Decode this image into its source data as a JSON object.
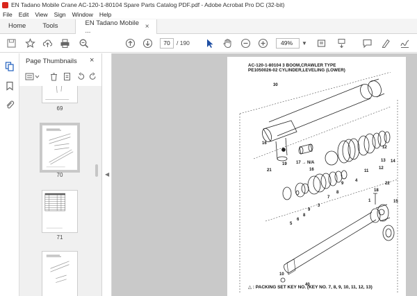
{
  "window": {
    "title": "EN Tadano Mobile Crane AC-120-1-80104 Spare Parts Catalog PDF.pdf - Adobe Acrobat Pro DC (32-bit)"
  },
  "menu": [
    "File",
    "Edit",
    "View",
    "Sign",
    "Window",
    "Help"
  ],
  "tabs": {
    "home": "Home",
    "tools": "Tools",
    "document": "EN Tadano Mobile ...",
    "close": "×"
  },
  "toolbar": {
    "current_page": "70",
    "page_total": "/ 190",
    "zoom": "49%",
    "icons": [
      "save-icon",
      "star-icon",
      "upload-icon",
      "print-icon",
      "find-icon",
      "prev-page-icon",
      "next-page-icon",
      "select-icon",
      "hand-icon",
      "zoom-out-icon",
      "zoom-in-icon",
      "fit-icon",
      "scroll-icon",
      "comment-icon",
      "highlight-icon",
      "sign-icon"
    ]
  },
  "panel": {
    "title": "Page Thumbnails",
    "close": "×",
    "thumbnails": [
      {
        "label": "69"
      },
      {
        "label": "70"
      },
      {
        "label": "71"
      }
    ]
  },
  "document": {
    "heading_line1": "AC-120-1-80104 3 BOOM,CRAWLER TYPE",
    "heading_line2": "PE1050026-02 CYLINDER,LEVELING (LOWER)",
    "footer": "△ : PACKING  SET  KEY  NO. (KEY NO. 7, 8, 9, 10, 11, 12, 13)",
    "callouts": {
      "c30": "30",
      "c16a": "16",
      "c19": "19",
      "c17": "17 → N/A",
      "c16b": "16",
      "c21": "21",
      "c12a": "12",
      "c13": "13",
      "c14": "14",
      "c12b": "12",
      "c11": "11",
      "c4": "4",
      "c9a": "9",
      "c8a": "8",
      "c7": "7",
      "c3": "3",
      "c9b": "9",
      "c8b": "8",
      "c5": "5",
      "c6": "6",
      "c22": "22",
      "c18": "18",
      "c1": "1",
      "c15": "15",
      "c10": "10",
      "c40": "40"
    }
  }
}
